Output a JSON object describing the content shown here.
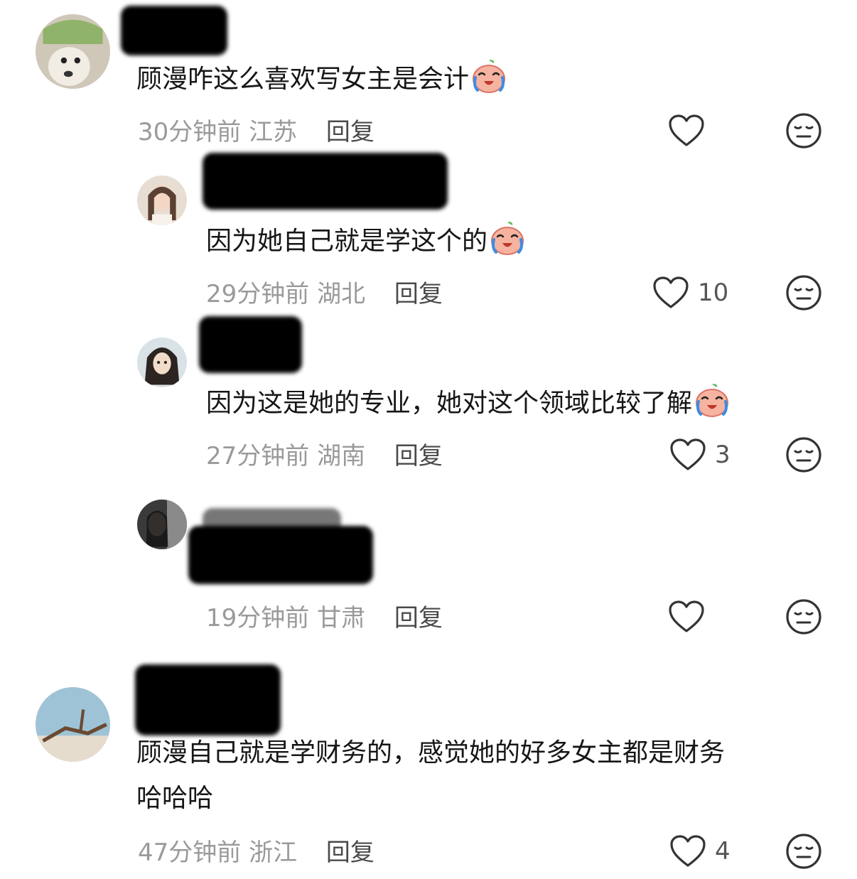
{
  "comments": [
    {
      "text": "顾漫咋这么喜欢写女主是会计",
      "emoji": "crying-laugh-emoji",
      "time": "30分钟前",
      "location": "江苏",
      "reply_label": "回复",
      "likes": ""
    },
    {
      "text": "因为她自己就是学这个的",
      "emoji": "crying-laugh-emoji",
      "time": "29分钟前",
      "location": "湖北",
      "reply_label": "回复",
      "likes": "10"
    },
    {
      "text": "因为这是她的专业，她对这个领域比较了解",
      "emoji": "crying-laugh-emoji",
      "time": "27分钟前",
      "location": "湖南",
      "reply_label": "回复",
      "likes": "3"
    },
    {
      "text": "",
      "time": "19分钟前",
      "location": "甘肃",
      "reply_label": "回复",
      "likes": ""
    },
    {
      "text_line1": "顾漫自己就是学财务的，感觉她的好多女主都是财务",
      "text_line2": "哈哈哈",
      "time": "47分钟前",
      "location": "浙江",
      "reply_label": "回复",
      "likes": "4"
    }
  ],
  "colors": {
    "meta": "#9a9a9a",
    "reply": "#4a4a4a",
    "icon": "#333333"
  },
  "icons": {
    "like": "heart-outline-icon",
    "dislike": "meh-face-icon"
  }
}
